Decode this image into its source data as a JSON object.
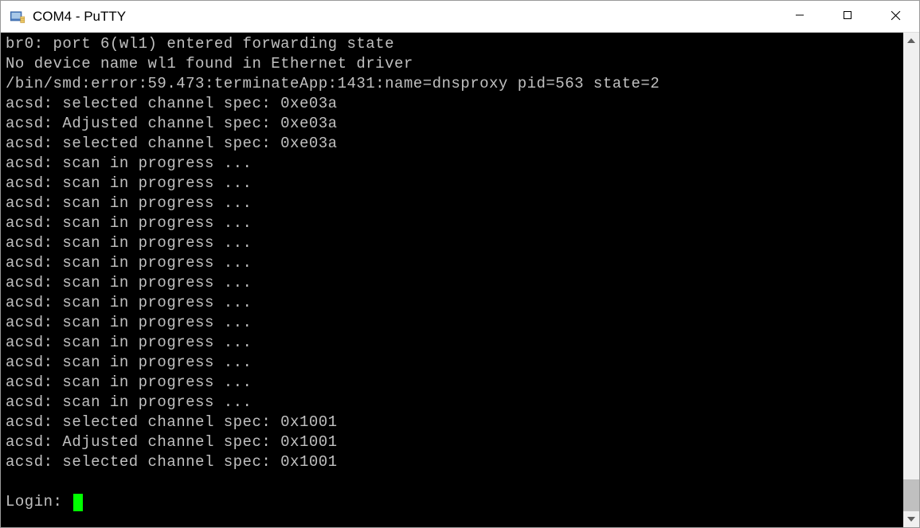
{
  "window": {
    "title": "COM4 - PuTTY"
  },
  "terminal": {
    "lines": [
      "br0: port 6(wl1) entered forwarding state",
      "No device name wl1 found in Ethernet driver",
      "/bin/smd:error:59.473:terminateApp:1431:name=dnsproxy pid=563 state=2",
      "acsd: selected channel spec: 0xe03a",
      "acsd: Adjusted channel spec: 0xe03a",
      "acsd: selected channel spec: 0xe03a",
      "acsd: scan in progress ...",
      "acsd: scan in progress ...",
      "acsd: scan in progress ...",
      "acsd: scan in progress ...",
      "acsd: scan in progress ...",
      "acsd: scan in progress ...",
      "acsd: scan in progress ...",
      "acsd: scan in progress ...",
      "acsd: scan in progress ...",
      "acsd: scan in progress ...",
      "acsd: scan in progress ...",
      "acsd: scan in progress ...",
      "acsd: scan in progress ...",
      "acsd: selected channel spec: 0x1001",
      "acsd: Adjusted channel spec: 0x1001",
      "acsd: selected channel spec: 0x1001",
      ""
    ],
    "prompt": "Login: "
  }
}
